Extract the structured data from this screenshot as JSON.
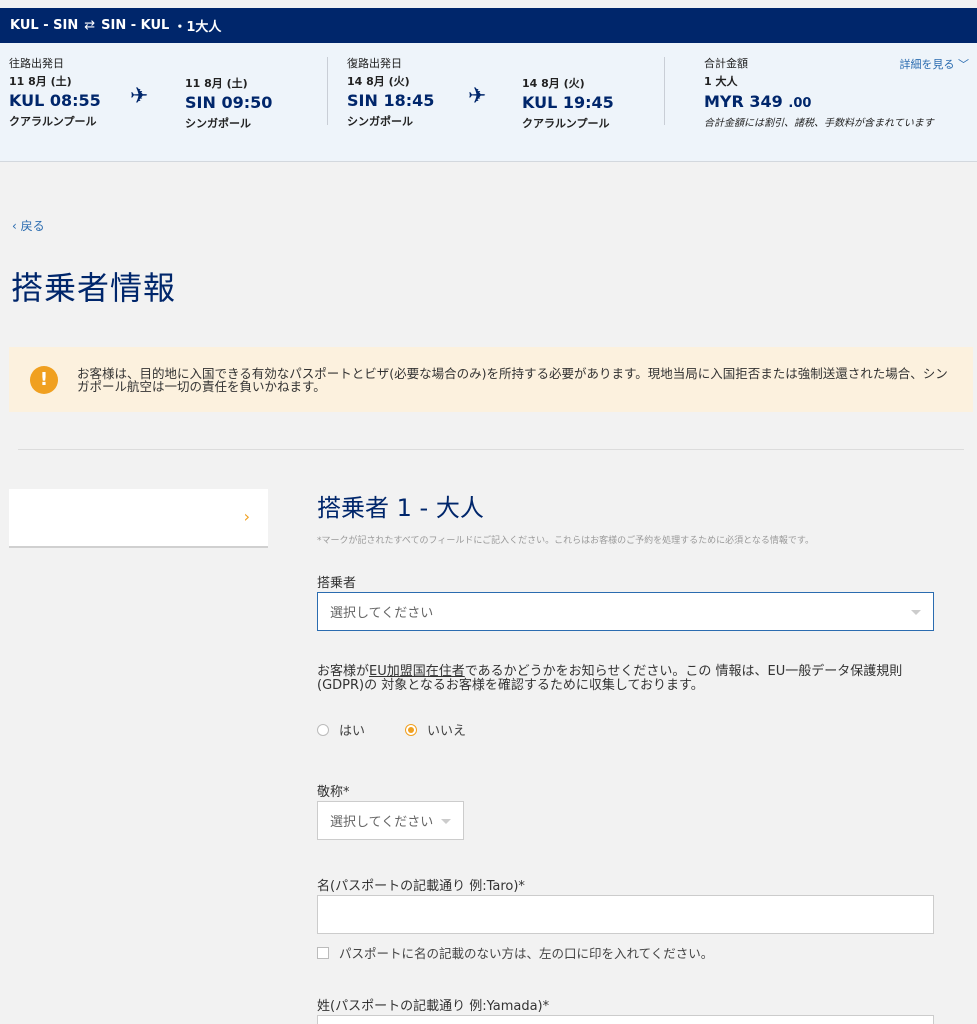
{
  "header": {
    "route_out": "KUL - SIN",
    "swap_icon": "⇄",
    "route_back": "SIN - KUL",
    "pax": "・1大人"
  },
  "outbound": {
    "label": "往路出発日",
    "dep_date": "11 8月 (土)",
    "dep_code_time": "KUL 08:55",
    "dep_city": "クアラルンプール",
    "arr_date": "11 8月 (土)",
    "arr_code_time": "SIN 09:50",
    "arr_city": "シンガポール"
  },
  "inbound": {
    "label": "復路出発日",
    "dep_date": "14 8月 (火)",
    "dep_code_time": "SIN 18:45",
    "dep_city": "シンガポール",
    "arr_date": "14 8月 (火)",
    "arr_code_time": "KUL 19:45",
    "arr_city": "クアラルンプール"
  },
  "price": {
    "label": "合計金額",
    "pax": "1 大人",
    "amount": "MYR 349",
    "decimals": ".00",
    "note": "合計金額には割引、諸税、手数料が含まれています",
    "details_link": "詳細を見る ﹀"
  },
  "nav": {
    "back": "‹ 戻る"
  },
  "page_title": "搭乗者情報",
  "warning": {
    "icon": "!",
    "text": "お客様は、目的地に入国できる有効なパスポートとビザ(必要な場合のみ)を所持する必要があります。現地当局に入国拒否または強制送還された場合、シンガポール航空は一切の責任を負いかねます。"
  },
  "sidebar": {
    "chevron": "›"
  },
  "form": {
    "title": "搭乗者 1 - 大人",
    "hint": "*マークが記されたすべてのフィールドにご記入ください。これらはお客様のご予約を処理するために必須となる情報です。",
    "passenger_label": "搭乗者",
    "passenger_placeholder": "選択してください",
    "gdpr_pre": "お客様が",
    "gdpr_link": "EU加盟国在住者",
    "gdpr_post": "であるかどうかをお知らせください。この 情報は、EU一般データ保護規則(GDPR)の 対象となるお客様を確認するために収集しております。",
    "radio_yes": "はい",
    "radio_no": "いいえ",
    "title_label": "敬称*",
    "title_placeholder": "選択してください",
    "first_name_label": "名(パスポートの記載通り 例:Taro)*",
    "no_first_name_check": "パスポートに名の記載のない方は、左の口に印を入れてください。",
    "last_name_label": "姓(パスポートの記載通り 例:Yamada)*"
  }
}
